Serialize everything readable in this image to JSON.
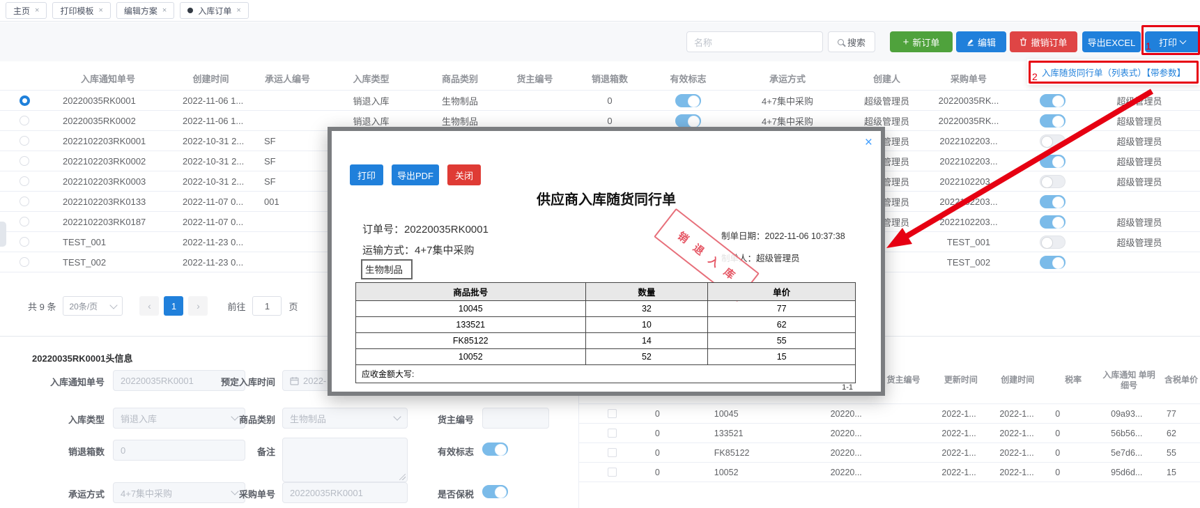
{
  "tabs": {
    "close_glyph": "×",
    "items": [
      {
        "label": "主页"
      },
      {
        "label": "打印模板"
      },
      {
        "label": "编辑方案"
      },
      {
        "label": "入库订单",
        "active": true
      }
    ]
  },
  "toolbar": {
    "search_placeholder": "名称",
    "search_label": "搜索",
    "new_order_label": "新订单",
    "new_order_plus": "+",
    "edit_label": "编辑",
    "cancel_label": "撤销订单",
    "export_label": "导出EXCEL",
    "print_label": "打印"
  },
  "print_menu": {
    "item_label": "入库随货同行单（列表式）【带参数】"
  },
  "annotations": {
    "step1": "1",
    "step2": "2"
  },
  "orders_table": {
    "headers": [
      "",
      "入库通知单号",
      "创建时间",
      "承运人编号",
      "入库类型",
      "商品类别",
      "货主编号",
      "销退箱数",
      "有效标志",
      "承运方式",
      "创建人",
      "采购单号",
      "",
      ""
    ],
    "rows": [
      [
        true,
        "20220035RK0001",
        "2022-11-06 1...",
        "",
        "销退入库",
        "生物制品",
        "",
        "0",
        true,
        "4+7集中采购",
        "超级管理员",
        "20220035RK...",
        true,
        "超级管理员"
      ],
      [
        false,
        "20220035RK0002",
        "2022-11-06 1...",
        "",
        "销退入库",
        "生物制品",
        "",
        "0",
        true,
        "4+7集中采购",
        "超级管理员",
        "20220035RK...",
        true,
        "超级管理员"
      ],
      [
        false,
        "2022102203RK0001",
        "2022-10-31 2...",
        "SF",
        "",
        "",
        "",
        "",
        null,
        "",
        "超级管理员",
        "2022102203...",
        false,
        "超级管理员"
      ],
      [
        false,
        "2022102203RK0002",
        "2022-10-31 2...",
        "SF",
        "",
        "",
        "",
        "",
        null,
        "",
        "超级管理员",
        "2022102203...",
        true,
        "超级管理员"
      ],
      [
        false,
        "2022102203RK0003",
        "2022-10-31 2...",
        "SF",
        "",
        "",
        "",
        "",
        null,
        "",
        "超级管理员",
        "2022102203...",
        false,
        "超级管理员"
      ],
      [
        false,
        "2022102203RK0133",
        "2022-11-07 0...",
        "001",
        "",
        "",
        "",
        "",
        null,
        "",
        "超级管理员",
        "2022102203...",
        true,
        ""
      ],
      [
        false,
        "2022102203RK0187",
        "2022-11-07 0...",
        "",
        "",
        "",
        "",
        "",
        null,
        "",
        "超级管理员",
        "2022102203...",
        true,
        "超级管理员"
      ],
      [
        false,
        "TEST_001",
        "2022-11-23 0...",
        "",
        "",
        "",
        "",
        "",
        null,
        "",
        "",
        "TEST_001",
        false,
        "超级管理员"
      ],
      [
        false,
        "TEST_002",
        "2022-11-23 0...",
        "",
        "",
        "",
        "",
        "",
        null,
        "",
        "",
        "TEST_002",
        true,
        ""
      ]
    ]
  },
  "pagination": {
    "total": "共 9 条",
    "page_size": "20条/页",
    "prev": "‹",
    "page": "1",
    "next": "›",
    "goto_label": "前往",
    "goto_value": "1",
    "unit": "页"
  },
  "head_form": {
    "section_title": "20220035RK0001头信息",
    "notice_no": {
      "label": "入库通知单号",
      "value": "20220035RK0001"
    },
    "planned_time": {
      "label": "预定入库时间",
      "value": "2022-"
    },
    "type": {
      "label": "入库类型",
      "value": "销退入库"
    },
    "category": {
      "label": "商品类别",
      "value": "生物制品"
    },
    "owner_no": {
      "label": "货主编号",
      "value": ""
    },
    "return_boxes": {
      "label": "销退箱数",
      "value": "0"
    },
    "remark": {
      "label": "备注",
      "value": ""
    },
    "valid": {
      "label": "有效标志",
      "on": true
    },
    "transport": {
      "label": "承运方式",
      "value": "4+7集中采购"
    },
    "po_no": {
      "label": "采购单号",
      "value": "20220035RK0001"
    },
    "bonded": {
      "label": "是否保税",
      "on": true
    }
  },
  "detail_table": {
    "headers": [
      "",
      "",
      "",
      "",
      "",
      "货主编号",
      "更新时间",
      "创建时间",
      "税率",
      "入库通知 单明细号",
      "含税单价"
    ],
    "rows": [
      [
        false,
        "0",
        "10045",
        "",
        "20220...",
        "",
        "2022-1...",
        "2022-1...",
        "0",
        "09a93...",
        "77"
      ],
      [
        false,
        "0",
        "133521",
        "",
        "20220...",
        "",
        "2022-1...",
        "2022-1...",
        "0",
        "56b56...",
        "62"
      ],
      [
        false,
        "0",
        "FK85122",
        "",
        "20220...",
        "",
        "2022-1...",
        "2022-1...",
        "0",
        "5e7d6...",
        "55"
      ],
      [
        false,
        "0",
        "10052",
        "",
        "20220...",
        "",
        "2022-1...",
        "2022-1...",
        "0",
        "95d6d...",
        "15"
      ]
    ]
  },
  "modal": {
    "close_glyph": "×",
    "print_label": "打印",
    "export_pdf_label": "导出PDF",
    "close_label": "关闭",
    "title": "供应商入库随货同行单",
    "order_no": "订单号：20220035RK0001",
    "transport": "运输方式：4+7集中采购",
    "category_box": "生物制品",
    "made_date": "制单日期：2022-11-06 10:37:38",
    "made_by": "制单人：超级管理员",
    "stamp": "销退入库",
    "table": {
      "headers": [
        "商品批号",
        "数量",
        "单价"
      ],
      "rows": [
        [
          "10045",
          "32",
          "77"
        ],
        [
          "133521",
          "10",
          "62"
        ],
        [
          "FK85122",
          "14",
          "55"
        ],
        [
          "10052",
          "52",
          "15"
        ]
      ],
      "footer": "应收金额大写:"
    },
    "page_indicator": "1-1"
  },
  "colors": {
    "accent_blue": "#2080db",
    "green": "#4fa23c",
    "red": "#df4545",
    "annotation_red": "#e60012",
    "toggle_on": "#7bbbe9"
  }
}
